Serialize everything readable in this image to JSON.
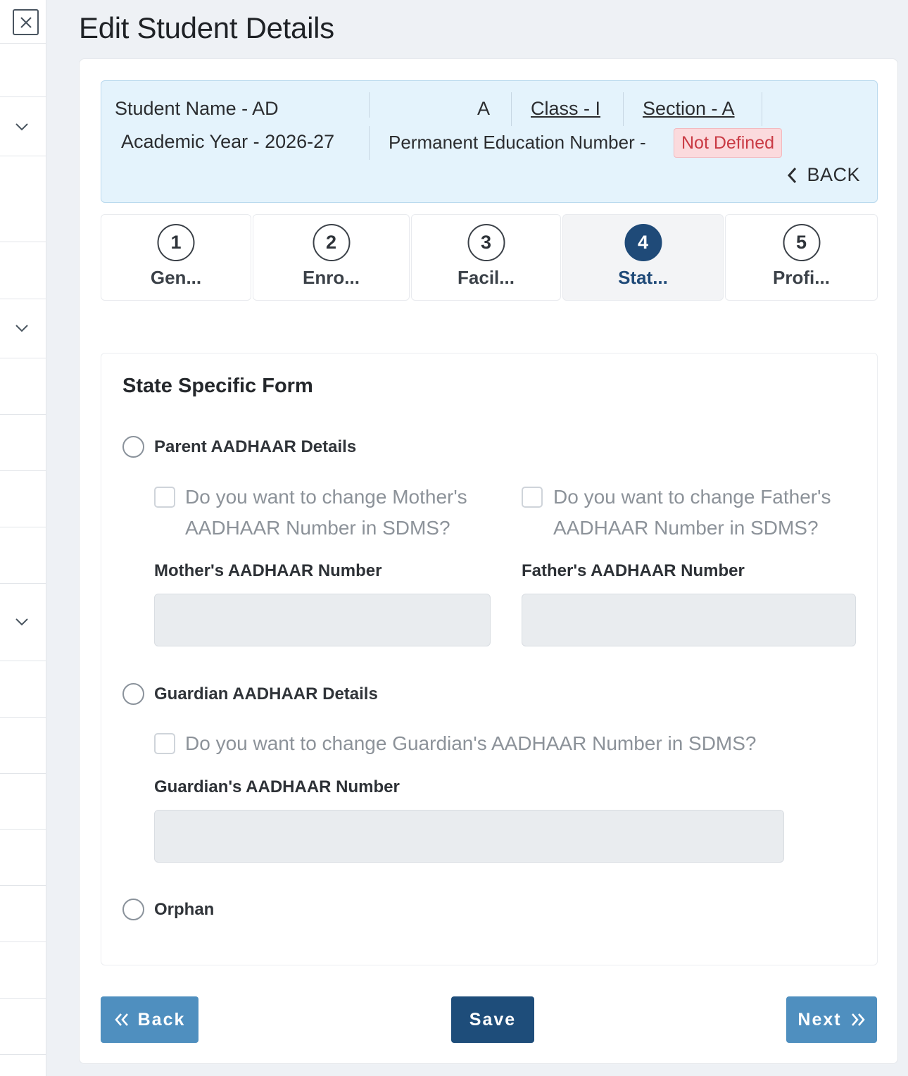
{
  "page": {
    "title": "Edit Student Details"
  },
  "banner": {
    "student_name": "Student Name - AD",
    "student_name_extra": "A",
    "class_label": "Class - I",
    "section_label": "Section - A",
    "academic_year": "Academic Year - 2026-27",
    "pen_label": "Permanent Education Number -",
    "pen_value": "Not Defined",
    "back_label": "BACK"
  },
  "steps": [
    {
      "number": "1",
      "label": "Gen..."
    },
    {
      "number": "2",
      "label": "Enro..."
    },
    {
      "number": "3",
      "label": "Facil..."
    },
    {
      "number": "4",
      "label": "Stat..."
    },
    {
      "number": "5",
      "label": "Profi..."
    }
  ],
  "active_step": "4",
  "form": {
    "heading": "State Specific Form",
    "parent_option": "Parent AADHAAR Details",
    "mother_question": "Do you want to change Mother's AADHAAR Number in SDMS?",
    "father_question": "Do you want to change Father's AADHAAR Number in SDMS?",
    "mother_label": "Mother's AADHAAR Number",
    "father_label": "Father's AADHAAR Number",
    "mother_value": "",
    "father_value": "",
    "guardian_option": "Guardian AADHAAR Details",
    "guardian_question": "Do you want to change Guardian's AADHAAR Number in SDMS?",
    "guardian_label": "Guardian's AADHAAR Number",
    "guardian_value": "",
    "orphan_option": "Orphan"
  },
  "buttons": {
    "back": "Back",
    "save": "Save",
    "next": "Next"
  },
  "colors": {
    "primary_dark": "#1e4d7a",
    "primary_light": "#4f8fbf",
    "banner_bg": "#e4f3fc",
    "badge_text": "#c93a44"
  }
}
